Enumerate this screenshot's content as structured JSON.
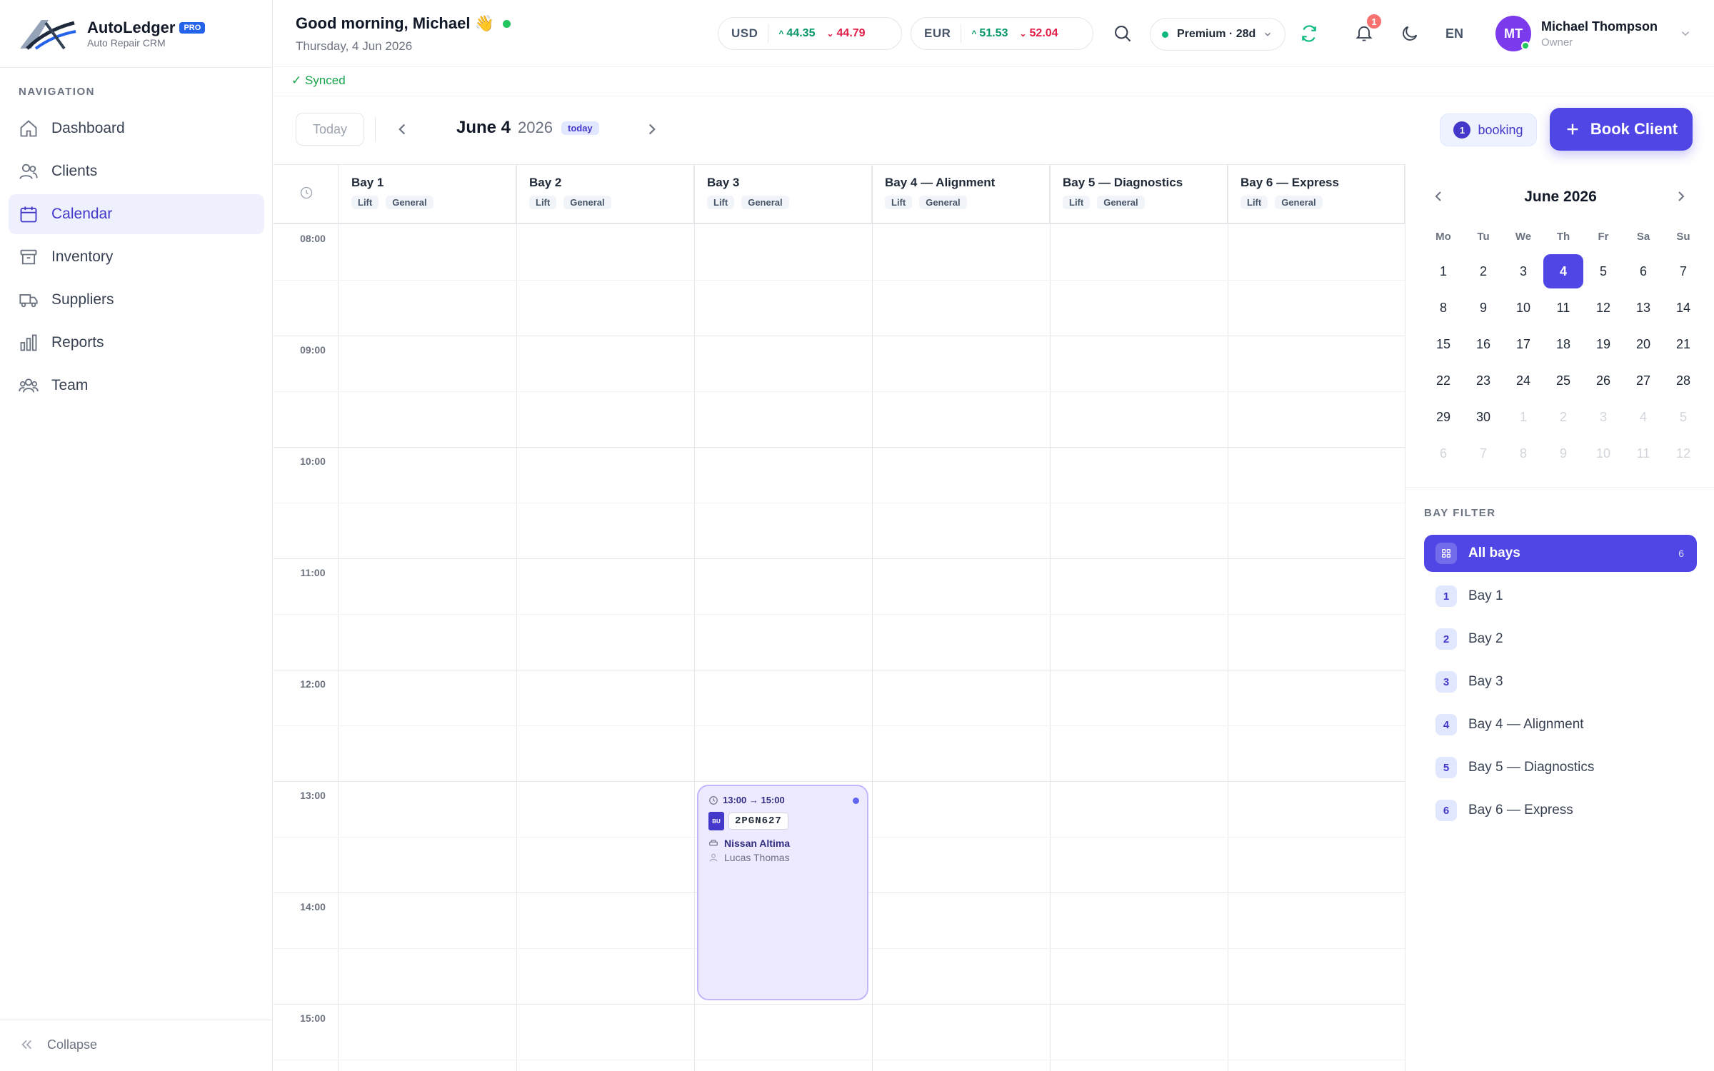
{
  "brand": {
    "name": "AutoLedger",
    "badge": "PRO",
    "subtitle": "Auto Repair CRM"
  },
  "nav": {
    "title": "NAVIGATION",
    "items": [
      {
        "label": "Dashboard",
        "icon": "home-icon"
      },
      {
        "label": "Clients",
        "icon": "users-icon"
      },
      {
        "label": "Calendar",
        "icon": "calendar-icon",
        "active": true
      },
      {
        "label": "Inventory",
        "icon": "archive-icon"
      },
      {
        "label": "Suppliers",
        "icon": "truck-icon"
      },
      {
        "label": "Reports",
        "icon": "bar-chart-icon"
      },
      {
        "label": "Team",
        "icon": "team-icon"
      }
    ],
    "collapse_label": "Collapse"
  },
  "header": {
    "greeting": "Good morning, Michael 👋",
    "date": "Thursday, 4 Jun 2026",
    "currencies": [
      {
        "code": "USD",
        "buy": "44.35",
        "sell": "44.79"
      },
      {
        "code": "EUR",
        "buy": "51.53",
        "sell": "52.04"
      }
    ],
    "plan": "Premium · 28d",
    "notifications": "1",
    "language": "EN",
    "user": {
      "initials": "MT",
      "name": "Michael Thompson",
      "role": "Owner"
    },
    "sync_status": "✓ Synced"
  },
  "toolbar": {
    "today_label": "Today",
    "month_day": "June 4",
    "year": "2026",
    "today_tag": "today",
    "booking_count": "1",
    "booking_label": "booking",
    "book_button": "Book Client"
  },
  "bays": [
    {
      "name": "Bay 1",
      "tags": [
        "Lift",
        "General"
      ]
    },
    {
      "name": "Bay 2",
      "tags": [
        "Lift",
        "General"
      ]
    },
    {
      "name": "Bay 3",
      "tags": [
        "Lift",
        "General"
      ]
    },
    {
      "name": "Bay 4 — Alignment",
      "tags": [
        "Lift",
        "General"
      ]
    },
    {
      "name": "Bay 5 — Diagnostics",
      "tags": [
        "Lift",
        "General"
      ]
    },
    {
      "name": "Bay 6 — Express",
      "tags": [
        "Lift",
        "General"
      ]
    }
  ],
  "hours": [
    "08:00",
    "09:00",
    "10:00",
    "11:00",
    "12:00",
    "13:00",
    "14:00",
    "15:00"
  ],
  "booking": {
    "time": "13:00 → 15:00",
    "plate_flag": "BU",
    "plate": "2PGN627",
    "vehicle": "Nissan Altima",
    "client": "Lucas Thomas",
    "bay": "Bay 3"
  },
  "mini_calendar": {
    "title": "June 2026",
    "weekdays": [
      "Mo",
      "Tu",
      "We",
      "Th",
      "Fr",
      "Sa",
      "Su"
    ],
    "days": [
      "1",
      "2",
      "3",
      "4",
      "5",
      "6",
      "7",
      "8",
      "9",
      "10",
      "11",
      "12",
      "13",
      "14",
      "15",
      "16",
      "17",
      "18",
      "19",
      "20",
      "21",
      "22",
      "23",
      "24",
      "25",
      "26",
      "27",
      "28",
      "29",
      "30",
      "1",
      "2",
      "3",
      "4",
      "5",
      "6",
      "7",
      "8",
      "9",
      "10",
      "11",
      "12"
    ],
    "selected": "4"
  },
  "bay_filter": {
    "title": "BAY FILTER",
    "all_label": "All bays",
    "all_count": "6",
    "items": [
      {
        "num": "1",
        "label": "Bay 1"
      },
      {
        "num": "2",
        "label": "Bay 2"
      },
      {
        "num": "3",
        "label": "Bay 3"
      },
      {
        "num": "4",
        "label": "Bay 4 — Alignment"
      },
      {
        "num": "5",
        "label": "Bay 5 — Diagnostics"
      },
      {
        "num": "6",
        "label": "Bay 6 — Express"
      }
    ]
  }
}
